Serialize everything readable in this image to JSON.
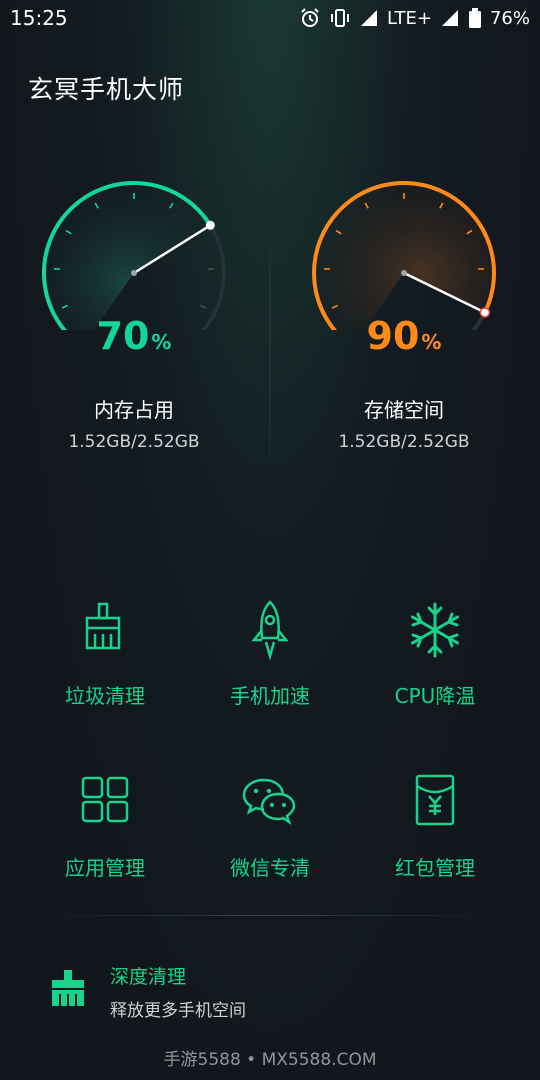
{
  "status_bar": {
    "time": "15:25",
    "network": "LTE+",
    "battery": "76%",
    "icons": [
      "alarm-icon",
      "vibrate-icon",
      "signal-icon",
      "battery-icon"
    ]
  },
  "app": {
    "title": "玄冥手机大师"
  },
  "gauges": [
    {
      "id": "memory",
      "percent": "70",
      "percent_value": 70,
      "unit": "%",
      "label": "内存占用",
      "value": "1.52GB/2.52GB",
      "color": "#14d69a"
    },
    {
      "id": "storage",
      "percent": "90",
      "percent_value": 90,
      "unit": "%",
      "label": "存储空间",
      "value": "1.52GB/2.52GB",
      "color": "#ff8a1a"
    }
  ],
  "tools": [
    {
      "label": "垃圾清理",
      "icon": "broom-icon"
    },
    {
      "label": "手机加速",
      "icon": "rocket-icon"
    },
    {
      "label": "CPU降温",
      "icon": "snowflake-icon"
    },
    {
      "label": "应用管理",
      "icon": "apps-grid-icon"
    },
    {
      "label": "微信专清",
      "icon": "wechat-icon"
    },
    {
      "label": "红包管理",
      "icon": "red-packet-icon"
    }
  ],
  "deep_clean": {
    "title": "深度清理",
    "subtitle": "释放更多手机空间",
    "icon": "brush-icon"
  },
  "watermark": "手游5588 • MX5588.COM",
  "colors": {
    "accent_green": "#19d28b",
    "accent_orange": "#ff8a1a",
    "background": "#11171d"
  }
}
